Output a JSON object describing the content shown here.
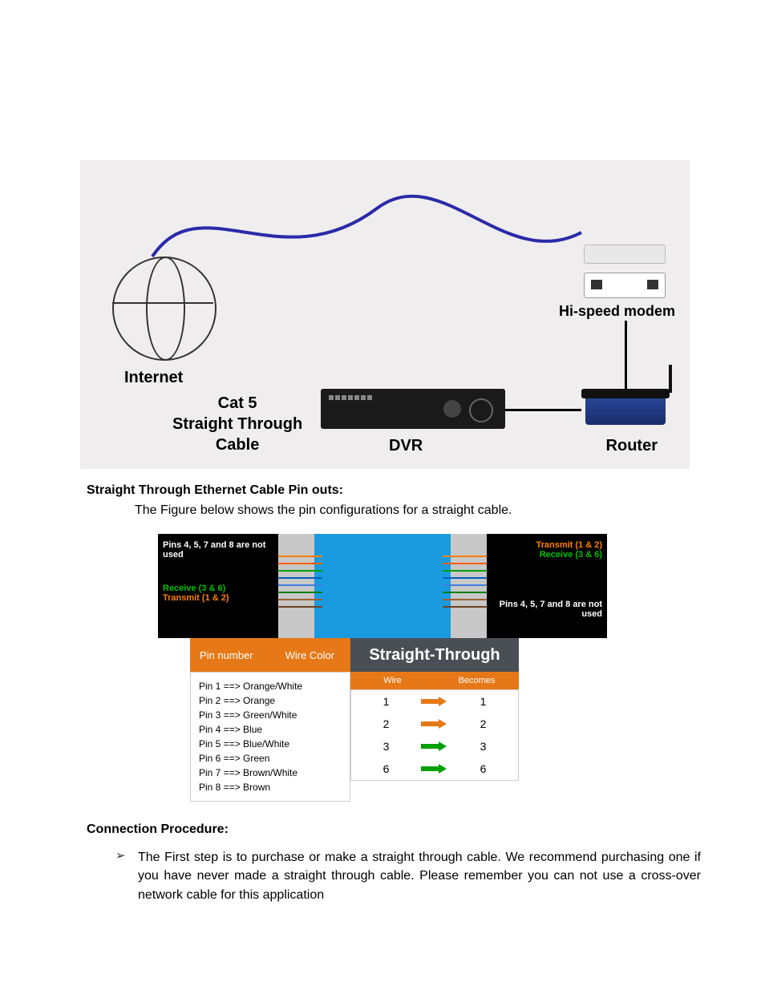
{
  "diagram1": {
    "internet": "Internet",
    "cable_line1": "Cat 5",
    "cable_line2": "Straight Through",
    "cable_line3": "Cable",
    "dvr": "DVR",
    "modem": "Hi-speed modem",
    "router": "Router"
  },
  "section1": {
    "heading": "Straight Through Ethernet Cable Pin outs:",
    "body": "The Figure below shows the pin configurations for a straight cable."
  },
  "diagram2": {
    "left": {
      "pins_note": "Pins 4, 5, 7 and 8 are not used",
      "rx": "Receive (3 & 6)",
      "tx": "Transmit (1 & 2)"
    },
    "right": {
      "tx": "Transmit (1 & 2)",
      "rx": "Receive (3 & 6)",
      "pins_note": "Pins 4, 5, 7 and 8 are not used"
    },
    "pin_header": {
      "col1": "Pin number",
      "col2": "Wire Color"
    },
    "pins": [
      "Pin 1 ==> Orange/White",
      "Pin 2 ==> Orange",
      "Pin 3 ==> Green/White",
      "Pin 4 ==> Blue",
      "Pin 5 ==> Blue/White",
      "Pin 6 ==> Green",
      "Pin 7 ==> Brown/White",
      "Pin 8 ==> Brown"
    ],
    "st_header": "Straight-Through",
    "st_sub": {
      "col1": "Wire",
      "col2": "Becomes"
    },
    "st_rows": [
      {
        "from": "1",
        "to": "1",
        "color": "orange"
      },
      {
        "from": "2",
        "to": "2",
        "color": "orange"
      },
      {
        "from": "3",
        "to": "3",
        "color": "green"
      },
      {
        "from": "6",
        "to": "6",
        "color": "green"
      }
    ]
  },
  "section2": {
    "heading": "Connection Procedure:",
    "bullet": "The First step is to purchase or make a straight through cable. We recommend purchasing one if you have never made a straight through cable. Please remember you can not use a cross-over network cable for this application"
  }
}
